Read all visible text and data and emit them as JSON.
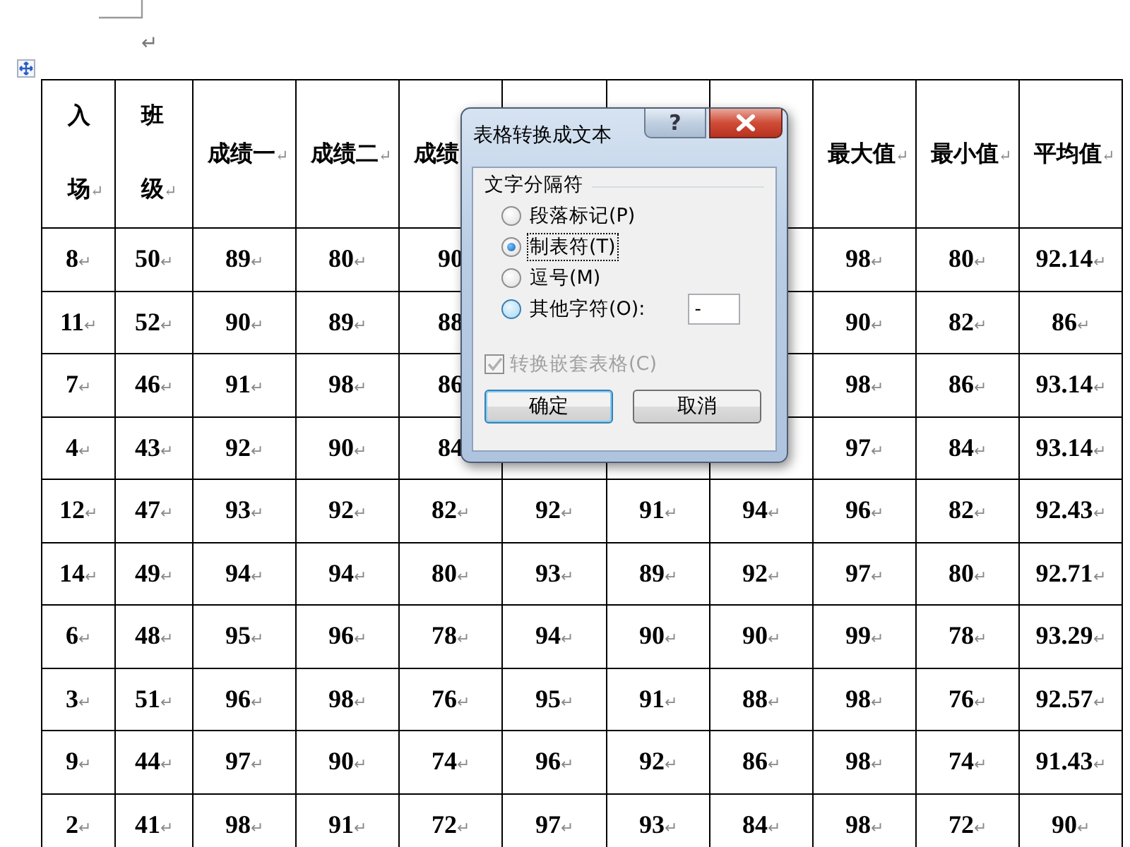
{
  "document": {
    "paragraph_mark": "↵",
    "table": {
      "columns": [
        {
          "label": "入场↵",
          "kind": "stacked"
        },
        {
          "label": "班级↵",
          "kind": "stacked"
        },
        {
          "label": "成绩一↵",
          "kind": "single"
        },
        {
          "label": "成绩二↵",
          "kind": "single"
        },
        {
          "label": "成绩",
          "kind": "single"
        },
        {
          "kind": "single"
        },
        {
          "kind": "single"
        },
        {
          "kind": "single"
        },
        {
          "label": "最大值↵",
          "kind": "single"
        },
        {
          "label": "最小值↵",
          "kind": "single"
        },
        {
          "label": "平均值↵",
          "kind": "single"
        }
      ],
      "rows": [
        [
          "8↵",
          "50↵",
          "89↵",
          "80↵",
          "90",
          null,
          null,
          null,
          "98↵",
          "80↵",
          "92.14↵"
        ],
        [
          "11↵",
          "52↵",
          "90↵",
          "89↵",
          "88",
          null,
          null,
          null,
          "90↵",
          "82↵",
          "86↵"
        ],
        [
          "7↵",
          "46↵",
          "91↵",
          "98↵",
          "86",
          null,
          null,
          null,
          "98↵",
          "86↵",
          "93.14↵"
        ],
        [
          "4↵",
          "43↵",
          "92↵",
          "90↵",
          "84",
          null,
          null,
          null,
          "97↵",
          "84↵",
          "93.14↵"
        ],
        [
          "12↵",
          "47↵",
          "93↵",
          "92↵",
          "82↵",
          "92↵",
          "91↵",
          "94↵",
          "96↵",
          "82↵",
          "92.43↵"
        ],
        [
          "14↵",
          "49↵",
          "94↵",
          "94↵",
          "80↵",
          "93↵",
          "89↵",
          "92↵",
          "97↵",
          "80↵",
          "92.71↵"
        ],
        [
          "6↵",
          "48↵",
          "95↵",
          "96↵",
          "78↵",
          "94↵",
          "90↵",
          "90↵",
          "99↵",
          "78↵",
          "93.29↵"
        ],
        [
          "3↵",
          "51↵",
          "96↵",
          "98↵",
          "76↵",
          "95↵",
          "91↵",
          "88↵",
          "98↵",
          "76↵",
          "92.57↵"
        ],
        [
          "9↵",
          "44↵",
          "97↵",
          "90↵",
          "74↵",
          "96↵",
          "92↵",
          "86↵",
          "98↵",
          "74↵",
          "91.43↵"
        ],
        [
          "2↵",
          "41↵",
          "98↵",
          "91↵",
          "72↵",
          "97↵",
          "93↵",
          "84↵",
          "98↵",
          "72↵",
          "90↵"
        ]
      ]
    }
  },
  "dialog": {
    "title": "表格转换成文本",
    "help_button": "?",
    "group_label": "文字分隔符",
    "options": [
      {
        "label": "段落标记(P)",
        "selected": false,
        "focused": false,
        "hovered": false
      },
      {
        "label": "制表符(T)",
        "selected": true,
        "focused": true,
        "hovered": false
      },
      {
        "label": "逗号(M)",
        "selected": false,
        "focused": false,
        "hovered": false
      },
      {
        "label": "其他字符(O):",
        "selected": false,
        "focused": false,
        "hovered": true
      }
    ],
    "other_value": "-",
    "nested_checkbox": {
      "label": "转换嵌套表格(C)",
      "checked": true,
      "disabled": true
    },
    "buttons": [
      {
        "label": "确定",
        "default": true
      },
      {
        "label": "取消",
        "default": false
      }
    ]
  }
}
